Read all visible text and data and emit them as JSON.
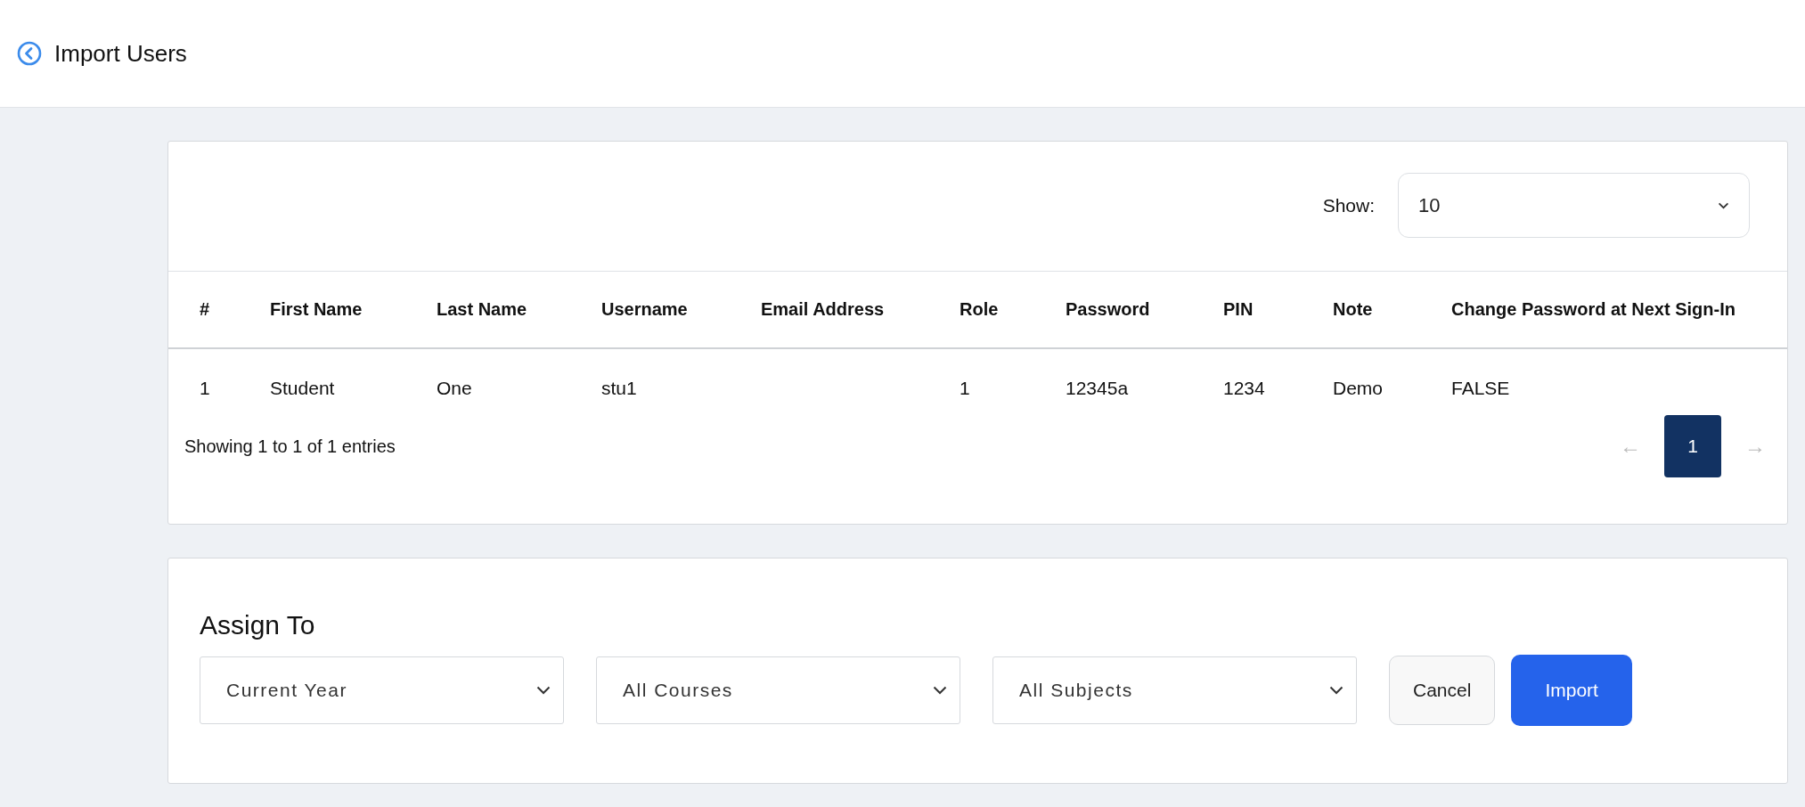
{
  "header": {
    "title": "Import Users"
  },
  "table_card": {
    "show_label": "Show:",
    "show_value": "10",
    "columns": [
      "#",
      "First Name",
      "Last Name",
      "Username",
      "Email Address",
      "Role",
      "Password",
      "PIN",
      "Note",
      "Change Password at Next Sign-In"
    ],
    "rows": [
      [
        "1",
        "Student",
        "One",
        "stu1",
        "",
        "1",
        "12345a",
        "1234",
        "Demo",
        "FALSE"
      ]
    ],
    "summary": "Showing 1 to 1 of 1 entries",
    "pagination": {
      "prev": "←",
      "next": "→",
      "pages": [
        {
          "label": "1",
          "selected": true
        }
      ]
    }
  },
  "assign": {
    "title": "Assign To",
    "selects": [
      "Current Year",
      "All Courses",
      "All Subjects"
    ],
    "buttons": [
      {
        "label": "Cancel",
        "kind": "secondary"
      },
      {
        "label": "Import",
        "kind": "primary"
      }
    ]
  }
}
